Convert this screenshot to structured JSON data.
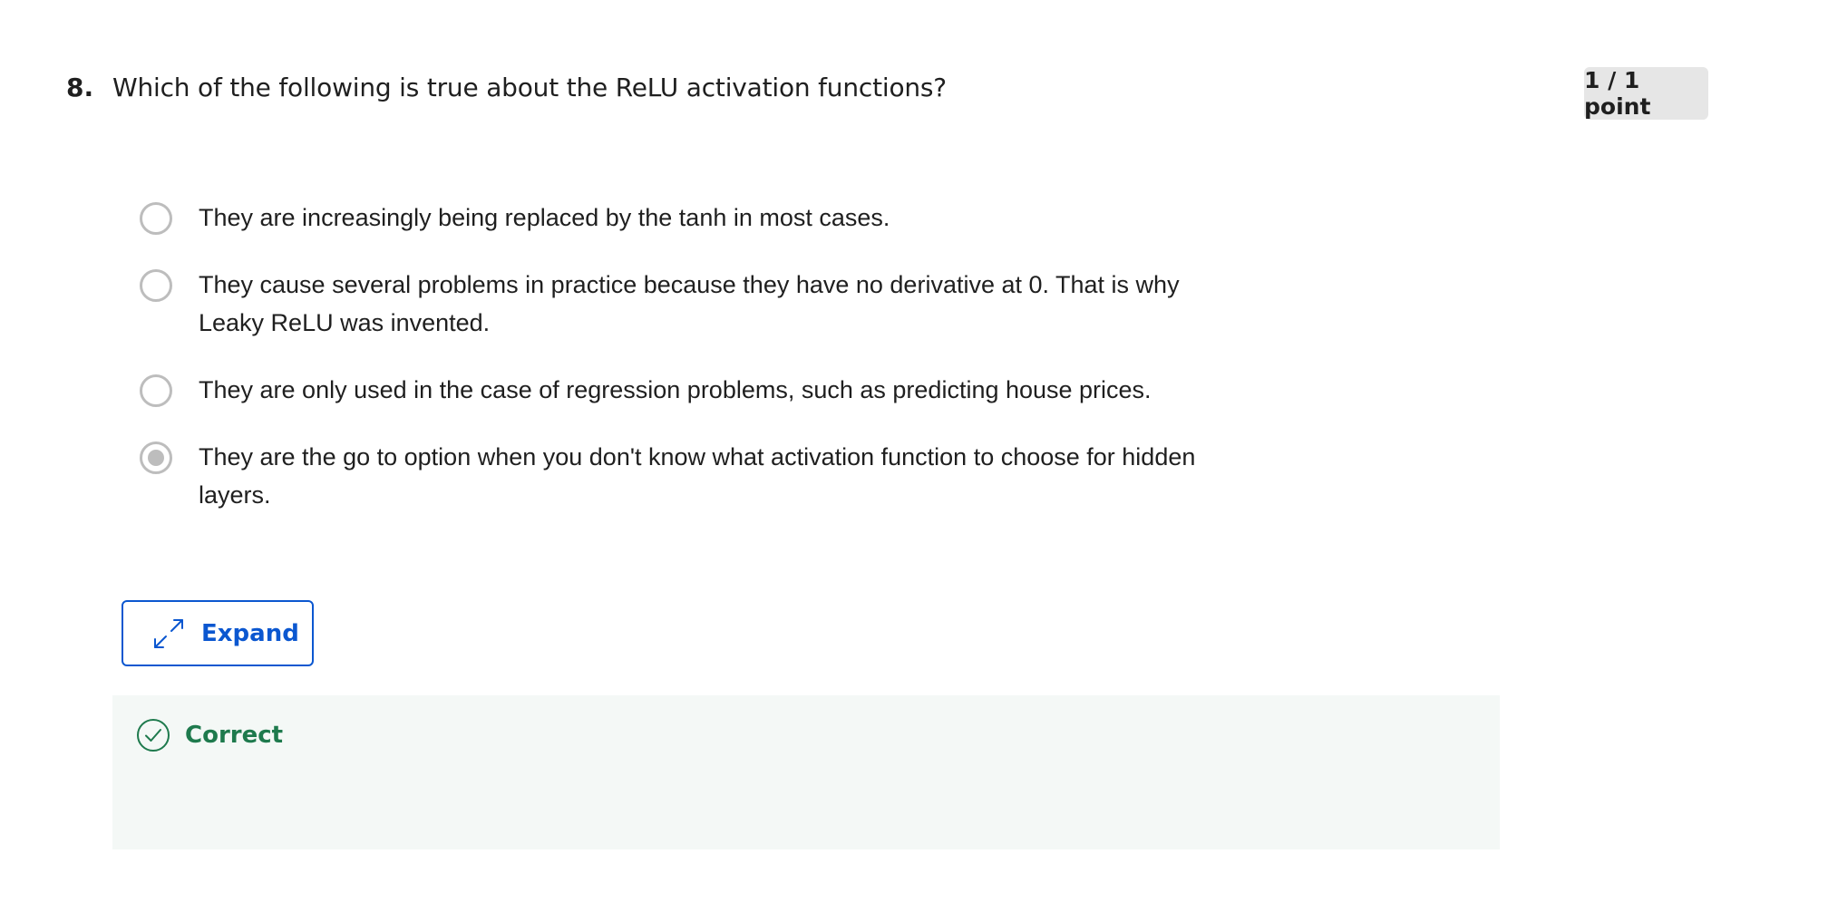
{
  "question": {
    "number": "8.",
    "text": "Which of the following is true about the ReLU activation functions?",
    "points": "1 / 1 point"
  },
  "options": [
    {
      "label": "They are increasingly being replaced by the tanh in most cases.",
      "selected": false
    },
    {
      "label": "They cause several problems in practice because they have no derivative at 0. That is why Leaky ReLU was invented.",
      "selected": false
    },
    {
      "label": "They are only used in the case of regression problems, such as predicting house prices.",
      "selected": false
    },
    {
      "label": "They are the go to option when you don't know what activation function to choose for hidden layers.",
      "selected": true
    }
  ],
  "expand": {
    "label": "Expand",
    "icon": "expand-arrows-icon"
  },
  "feedback": {
    "status": "Correct",
    "icon": "check-circle-icon"
  },
  "colors": {
    "accent_blue": "#0b57d0",
    "correct_green": "#1e7a4d",
    "feedback_bg": "#f4f8f6",
    "badge_bg": "#e6e6e6",
    "radio_gray": "#bdbdbd"
  }
}
